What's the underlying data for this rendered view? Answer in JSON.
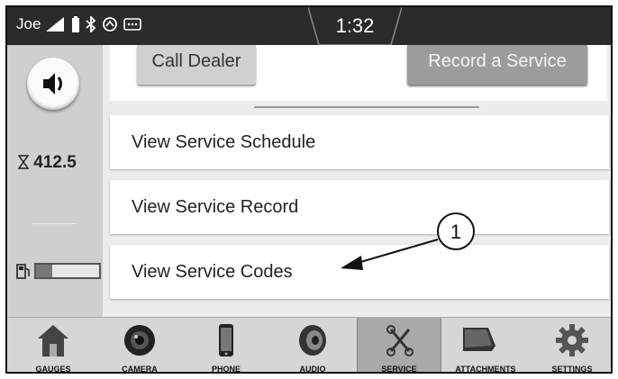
{
  "status": {
    "user": "Joe",
    "time": "1:32"
  },
  "rail": {
    "hours": "412.5",
    "fuel_level": 0.25,
    "volume_icon": "speaker-icon",
    "hours_icon": "hourglass-icon",
    "fuel_icon": "fuel-pump-icon"
  },
  "service": {
    "call_dealer": "Call Dealer",
    "record_service": "Record a Service",
    "items": [
      "View Service Schedule",
      "View Service Record",
      "View Service Codes"
    ]
  },
  "callout": {
    "number": "1"
  },
  "nav": {
    "gauges": "GAUGES",
    "camera": "CAMERA",
    "phone": "PHONE",
    "audio": "AUDIO",
    "service": "SERVICE",
    "attachments": "ATTACHMENTS",
    "settings": "SETTINGS"
  }
}
